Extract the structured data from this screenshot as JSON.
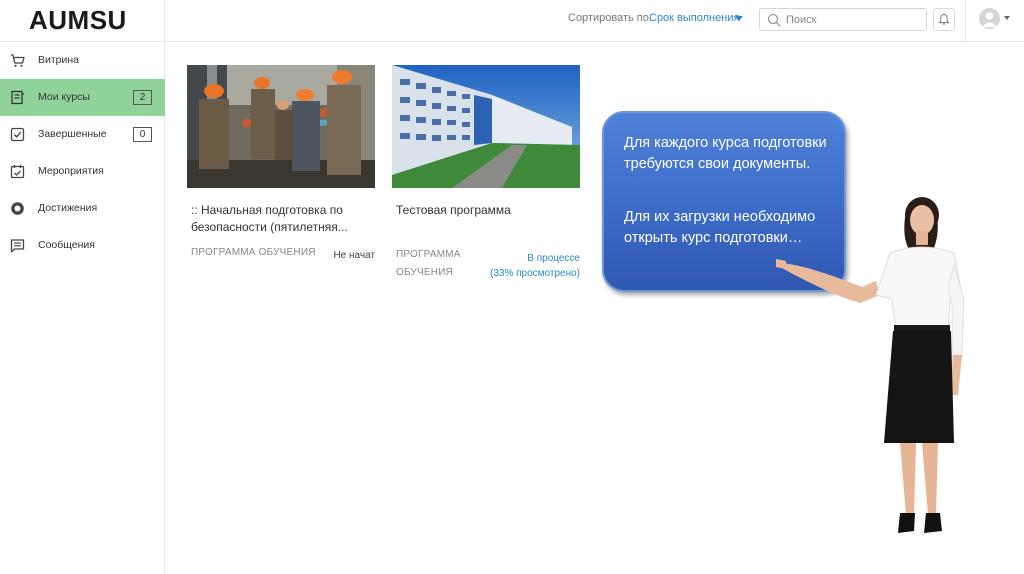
{
  "header": {
    "logo": "AUMSU",
    "sort_label": "Сортировать по:",
    "sort_value": "Срок выполнения",
    "search_placeholder": "Поиск"
  },
  "sidebar": {
    "items": [
      {
        "label": "Витрина",
        "icon": "cart-icon",
        "badge": ""
      },
      {
        "label": "Мои курсы",
        "icon": "book-icon",
        "badge": "2",
        "active": true
      },
      {
        "label": "Завершенные",
        "icon": "check-square-icon",
        "badge": "0"
      },
      {
        "label": "Мероприятия",
        "icon": "calendar-icon",
        "badge": ""
      },
      {
        "label": "Достижения",
        "icon": "award-icon",
        "badge": ""
      },
      {
        "label": "Сообщения",
        "icon": "message-icon",
        "badge": ""
      }
    ],
    "active_color": "#8fd39a"
  },
  "courses": [
    {
      "title": ":: Начальная подготовка по безопасности (пятилетняя...",
      "type": "ПРОГРАММА ОБУЧЕНИЯ",
      "status": "Не начат",
      "status_detail": ""
    },
    {
      "title": "Тестовая программа",
      "type": "ПРОГРАММА ОБУЧЕНИЯ",
      "status": "В процессе",
      "status_detail": "(33% просмотрено)",
      "progress": 0.33
    }
  ],
  "callout": {
    "line1": "Для каждого курса подготовки требуются свои документы.",
    "line2": "Для их загрузки необходимо открыть курс подготовки…"
  },
  "colors": {
    "accent": "#2a88c9",
    "callout_blue": "#3c6bc7"
  }
}
